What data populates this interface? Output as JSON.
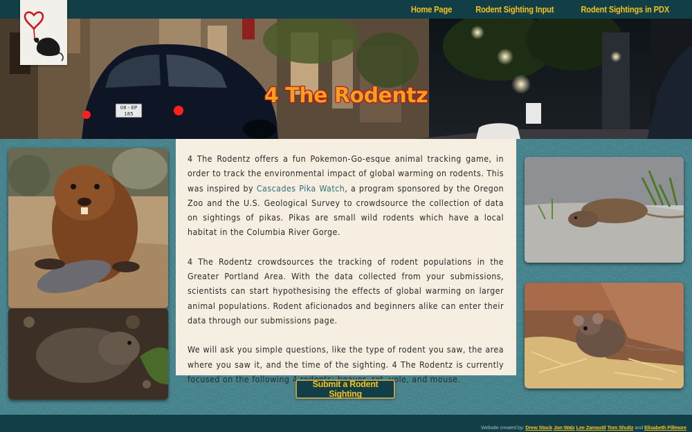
{
  "nav": {
    "items": [
      {
        "label": "Home Page"
      },
      {
        "label": "Rodent Sighting Input"
      },
      {
        "label": "Rodent Sightings in PDX"
      }
    ]
  },
  "hero": {
    "title": "4 The Rodentz",
    "plate_text": "08 - EP 185"
  },
  "content": {
    "p1_before": "4 The Rodentz offers a fun Pokemon-Go-esque animal tracking game, in order to track the environmental impact of global warming on rodents. This was inspired by ",
    "p1_link": "Cascades Pika Watch",
    "p1_after": ", a program sponsored by the Oregon Zoo and the U.S. Geological Survey to crowdsource the collection of data on sightings of pikas. Pikas are small wild rodents which have a local habitat in the Columbia River Gorge.",
    "p2": "4 The Rodentz crowdsources the tracking of rodent populations in the Greater Portland Area. With the data collected from your submissions, scientists can start hypothesising the effects of global warming on larger animal populations. Rodent aficionados and beginners alike can enter their data through our submissions page.",
    "p3": "We will ask you simple questions, like the type of rodent you saw, the area where you saw it, and the time of the sighting. 4 The Rodentz is currently focused on the following 4 rodents: beaver, rat, vole, and mouse."
  },
  "submit": {
    "label": "Submit a Rodent Sighting"
  },
  "footer": {
    "prefix": "Website created by:",
    "names": [
      "Drew Stock",
      "Jon Walz",
      "Lee Zamastil",
      "Tom Shultz"
    ],
    "and": "and",
    "last": "Elisabeth Fillmore"
  },
  "colors": {
    "accent": "#f2c21a",
    "navbar": "#123e48",
    "panel": "#f5eee1",
    "title_orange": "#f3a020"
  },
  "icons": {
    "logo": "heart-balloon-rat-icon"
  }
}
